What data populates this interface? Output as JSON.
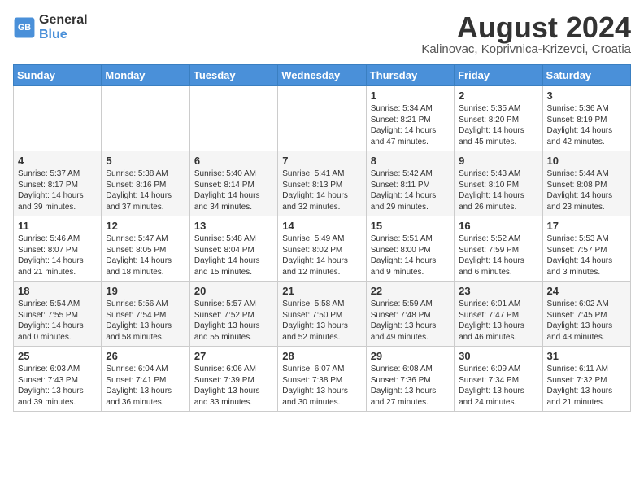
{
  "logo": {
    "line1": "General",
    "line2": "Blue"
  },
  "title": "August 2024",
  "subtitle": "Kalinovac, Koprivnica-Krizevci, Croatia",
  "weekdays": [
    "Sunday",
    "Monday",
    "Tuesday",
    "Wednesday",
    "Thursday",
    "Friday",
    "Saturday"
  ],
  "weeks": [
    [
      {
        "day": "",
        "info": ""
      },
      {
        "day": "",
        "info": ""
      },
      {
        "day": "",
        "info": ""
      },
      {
        "day": "",
        "info": ""
      },
      {
        "day": "1",
        "info": "Sunrise: 5:34 AM\nSunset: 8:21 PM\nDaylight: 14 hours\nand 47 minutes."
      },
      {
        "day": "2",
        "info": "Sunrise: 5:35 AM\nSunset: 8:20 PM\nDaylight: 14 hours\nand 45 minutes."
      },
      {
        "day": "3",
        "info": "Sunrise: 5:36 AM\nSunset: 8:19 PM\nDaylight: 14 hours\nand 42 minutes."
      }
    ],
    [
      {
        "day": "4",
        "info": "Sunrise: 5:37 AM\nSunset: 8:17 PM\nDaylight: 14 hours\nand 39 minutes."
      },
      {
        "day": "5",
        "info": "Sunrise: 5:38 AM\nSunset: 8:16 PM\nDaylight: 14 hours\nand 37 minutes."
      },
      {
        "day": "6",
        "info": "Sunrise: 5:40 AM\nSunset: 8:14 PM\nDaylight: 14 hours\nand 34 minutes."
      },
      {
        "day": "7",
        "info": "Sunrise: 5:41 AM\nSunset: 8:13 PM\nDaylight: 14 hours\nand 32 minutes."
      },
      {
        "day": "8",
        "info": "Sunrise: 5:42 AM\nSunset: 8:11 PM\nDaylight: 14 hours\nand 29 minutes."
      },
      {
        "day": "9",
        "info": "Sunrise: 5:43 AM\nSunset: 8:10 PM\nDaylight: 14 hours\nand 26 minutes."
      },
      {
        "day": "10",
        "info": "Sunrise: 5:44 AM\nSunset: 8:08 PM\nDaylight: 14 hours\nand 23 minutes."
      }
    ],
    [
      {
        "day": "11",
        "info": "Sunrise: 5:46 AM\nSunset: 8:07 PM\nDaylight: 14 hours\nand 21 minutes."
      },
      {
        "day": "12",
        "info": "Sunrise: 5:47 AM\nSunset: 8:05 PM\nDaylight: 14 hours\nand 18 minutes."
      },
      {
        "day": "13",
        "info": "Sunrise: 5:48 AM\nSunset: 8:04 PM\nDaylight: 14 hours\nand 15 minutes."
      },
      {
        "day": "14",
        "info": "Sunrise: 5:49 AM\nSunset: 8:02 PM\nDaylight: 14 hours\nand 12 minutes."
      },
      {
        "day": "15",
        "info": "Sunrise: 5:51 AM\nSunset: 8:00 PM\nDaylight: 14 hours\nand 9 minutes."
      },
      {
        "day": "16",
        "info": "Sunrise: 5:52 AM\nSunset: 7:59 PM\nDaylight: 14 hours\nand 6 minutes."
      },
      {
        "day": "17",
        "info": "Sunrise: 5:53 AM\nSunset: 7:57 PM\nDaylight: 14 hours\nand 3 minutes."
      }
    ],
    [
      {
        "day": "18",
        "info": "Sunrise: 5:54 AM\nSunset: 7:55 PM\nDaylight: 14 hours\nand 0 minutes."
      },
      {
        "day": "19",
        "info": "Sunrise: 5:56 AM\nSunset: 7:54 PM\nDaylight: 13 hours\nand 58 minutes."
      },
      {
        "day": "20",
        "info": "Sunrise: 5:57 AM\nSunset: 7:52 PM\nDaylight: 13 hours\nand 55 minutes."
      },
      {
        "day": "21",
        "info": "Sunrise: 5:58 AM\nSunset: 7:50 PM\nDaylight: 13 hours\nand 52 minutes."
      },
      {
        "day": "22",
        "info": "Sunrise: 5:59 AM\nSunset: 7:48 PM\nDaylight: 13 hours\nand 49 minutes."
      },
      {
        "day": "23",
        "info": "Sunrise: 6:01 AM\nSunset: 7:47 PM\nDaylight: 13 hours\nand 46 minutes."
      },
      {
        "day": "24",
        "info": "Sunrise: 6:02 AM\nSunset: 7:45 PM\nDaylight: 13 hours\nand 43 minutes."
      }
    ],
    [
      {
        "day": "25",
        "info": "Sunrise: 6:03 AM\nSunset: 7:43 PM\nDaylight: 13 hours\nand 39 minutes."
      },
      {
        "day": "26",
        "info": "Sunrise: 6:04 AM\nSunset: 7:41 PM\nDaylight: 13 hours\nand 36 minutes."
      },
      {
        "day": "27",
        "info": "Sunrise: 6:06 AM\nSunset: 7:39 PM\nDaylight: 13 hours\nand 33 minutes."
      },
      {
        "day": "28",
        "info": "Sunrise: 6:07 AM\nSunset: 7:38 PM\nDaylight: 13 hours\nand 30 minutes."
      },
      {
        "day": "29",
        "info": "Sunrise: 6:08 AM\nSunset: 7:36 PM\nDaylight: 13 hours\nand 27 minutes."
      },
      {
        "day": "30",
        "info": "Sunrise: 6:09 AM\nSunset: 7:34 PM\nDaylight: 13 hours\nand 24 minutes."
      },
      {
        "day": "31",
        "info": "Sunrise: 6:11 AM\nSunset: 7:32 PM\nDaylight: 13 hours\nand 21 minutes."
      }
    ]
  ]
}
